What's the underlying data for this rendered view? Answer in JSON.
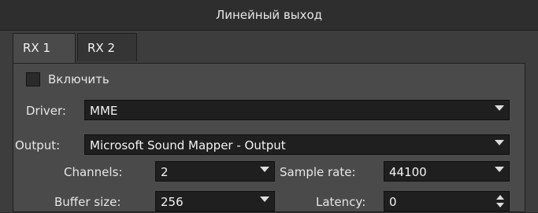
{
  "window": {
    "title": "Линейный выход"
  },
  "tabs": [
    {
      "label": "RX 1",
      "active": true
    },
    {
      "label": "RX 2",
      "active": false
    }
  ],
  "enable": {
    "label": "Включить",
    "checked": false
  },
  "driver": {
    "label": "Driver:",
    "value": "MME"
  },
  "output": {
    "label": "Output:",
    "value": "Microsoft Sound Mapper - Output"
  },
  "channels": {
    "label": "Channels:",
    "value": "2"
  },
  "sample_rate": {
    "label": "Sample rate:",
    "value": "44100"
  },
  "buffer_size": {
    "label": "Buffer size:",
    "value": "256"
  },
  "latency": {
    "label": "Latency:",
    "value": "0"
  }
}
